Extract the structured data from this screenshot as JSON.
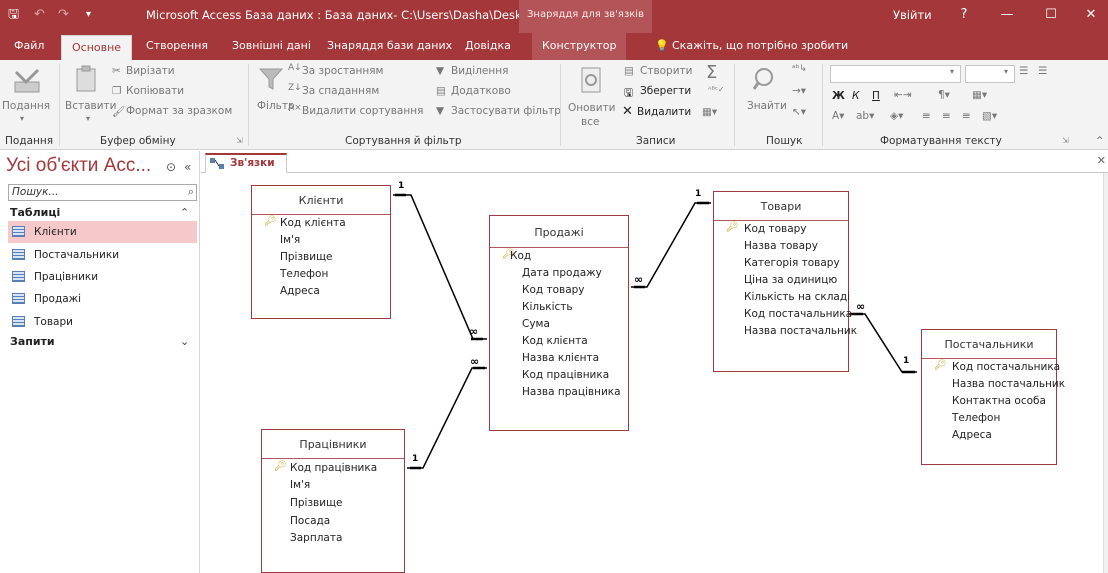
{
  "titlebar": {
    "qat": [
      "🖫",
      "↶",
      "↷",
      "▾"
    ],
    "title": "Microsoft Access База даних : База даних- C:\\Users\\Dasha\\Desktop\\...",
    "contextual_group": "Знаряддя для зв'язків",
    "signin": "Увійти",
    "help": "?",
    "minimize": "—",
    "maximize": "☐",
    "close": "✕"
  },
  "tabs": {
    "file": "Файл",
    "home": "Основне",
    "create": "Створення",
    "external": "Зовнішні дані",
    "dbtools": "Знаряддя бази даних",
    "help": "Довідка",
    "design": "Конструктор",
    "tellme": "Скажіть, що потрібно зробити"
  },
  "ribbon": {
    "views": {
      "view": "Подання",
      "group": "Подання"
    },
    "clipboard": {
      "paste": "Вставити",
      "cut": "Вирізати",
      "copy": "Копіювати",
      "format_painter": "Формат за зразком",
      "group": "Буфер обміну"
    },
    "sort_filter": {
      "filter": "Фільтр",
      "ascending": "За зростанням",
      "descending": "За спаданням",
      "remove_sort": "Видалити сортування",
      "selection": "Виділення",
      "advanced": "Додатково",
      "toggle_filter": "Застосувати фільтр",
      "group": "Сортування й фільтр"
    },
    "records": {
      "refresh_all": "Оновити",
      "refresh_all_2": "все",
      "new": "Створити",
      "save": "Зберегти",
      "delete": "Видалити",
      "group": "Записи"
    },
    "find": {
      "find": "Знайти",
      "group": "Пошук"
    },
    "text_formatting": {
      "bold": "Ж",
      "italic": "К",
      "underline": "П",
      "group": "Форматування тексту"
    }
  },
  "nav": {
    "title": "Усі об'єкти Acc...",
    "search_placeholder": "Пошук...",
    "groups": {
      "tables": "Таблиці",
      "queries": "Запити"
    },
    "tables": [
      "Клієнти",
      "Постачальники",
      "Працівники",
      "Продажі",
      "Товари"
    ]
  },
  "doc": {
    "tab_label": "Зв'язки"
  },
  "tables": {
    "clients": {
      "title": "Клієнти",
      "fields": [
        "Код клієнта",
        "Ім'я",
        "Прізвище",
        "Телефон",
        "Адреса"
      ]
    },
    "employees": {
      "title": "Працівники",
      "fields": [
        "Код працівника",
        "Ім'я",
        "Прізвище",
        "Посада",
        "Зарплата"
      ]
    },
    "sales": {
      "title": "Продажі",
      "fields": [
        "Код",
        "Дата продажу",
        "Код товару",
        "Кількість",
        "Сума",
        "Код клієнта",
        "Назва клієнта",
        "Код працівника",
        "Назва працівника"
      ]
    },
    "goods": {
      "title": "Товари",
      "fields": [
        "Код товару",
        "Назва товару",
        "Категорія товару",
        "Ціна за одиницю",
        "Кількість на складі",
        "Код постачальника",
        "Назва постачальник"
      ]
    },
    "suppliers": {
      "title": "Постачальники",
      "fields": [
        "Код постачальника",
        "Назва постачальник",
        "Контактна особа",
        "Телефон",
        "Адреса"
      ]
    }
  },
  "relations": {
    "one": "1",
    "many": "∞"
  },
  "colors": {
    "accent": "#a4373a",
    "selected": "#f5c9c9"
  }
}
